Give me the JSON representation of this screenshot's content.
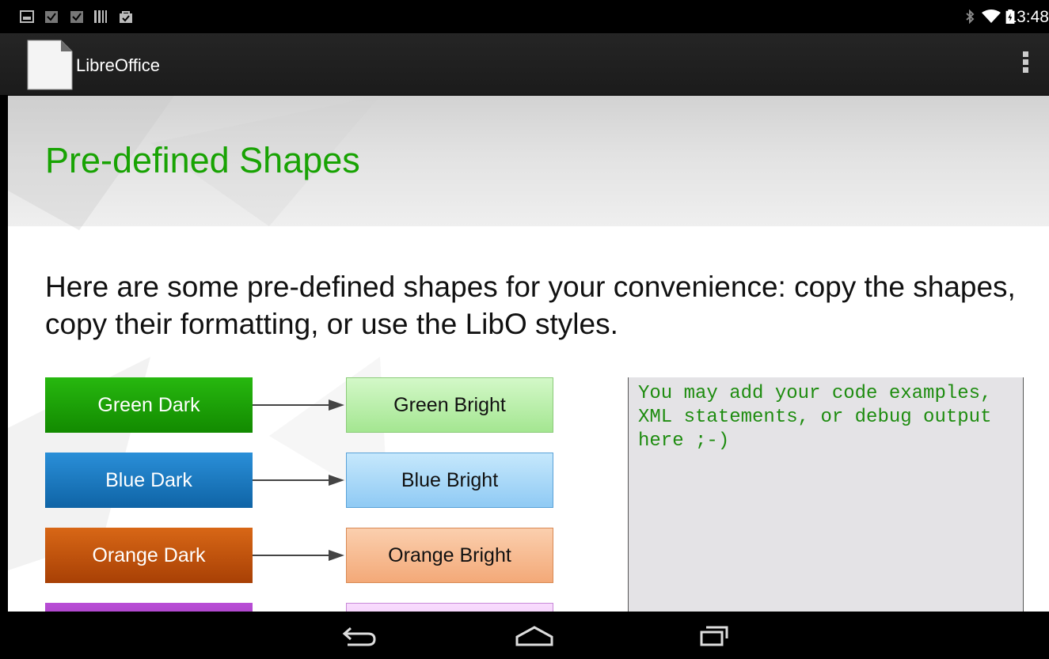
{
  "status_bar": {
    "notification_icons": [
      "image-icon",
      "checkbox-icon",
      "checkbox-icon",
      "barcode-icon",
      "shopping-bag-icon"
    ],
    "system_icons": [
      "bluetooth-icon",
      "wifi-icon",
      "battery-icon"
    ],
    "time": "13:48"
  },
  "action_bar": {
    "app_title": "LibreOffice",
    "menu_icon": "overflow-menu-icon"
  },
  "document": {
    "title": "Pre-defined Shapes",
    "intro": "Here are some pre-defined shapes for your convenience: copy the shapes, copy their formatting, or use the LibO styles.",
    "shape_rows": [
      {
        "dark": "Green Dark",
        "bright": "Green Bright",
        "dark_color": "#18a303",
        "bright_color": "#b4eea4"
      },
      {
        "dark": "Blue Dark",
        "bright": "Blue Bright",
        "dark_color": "#1a7ac4",
        "bright_color": "#9fd3f7"
      },
      {
        "dark": "Orange Dark",
        "bright": "Orange Bright",
        "dark_color": "#c4520c",
        "bright_color": "#f7b98e"
      },
      {
        "dark": "",
        "bright": "",
        "dark_color": "#a33ec0",
        "bright_color": "#f3c8fb"
      }
    ],
    "code_box_text": "You may add your code examples, XML statements, or debug output here ;-)"
  },
  "nav_bar": {
    "buttons": [
      "back-icon",
      "home-icon",
      "recent-apps-icon"
    ]
  },
  "colors": {
    "accent_green": "#18a303",
    "code_green": "#1e8c10"
  }
}
